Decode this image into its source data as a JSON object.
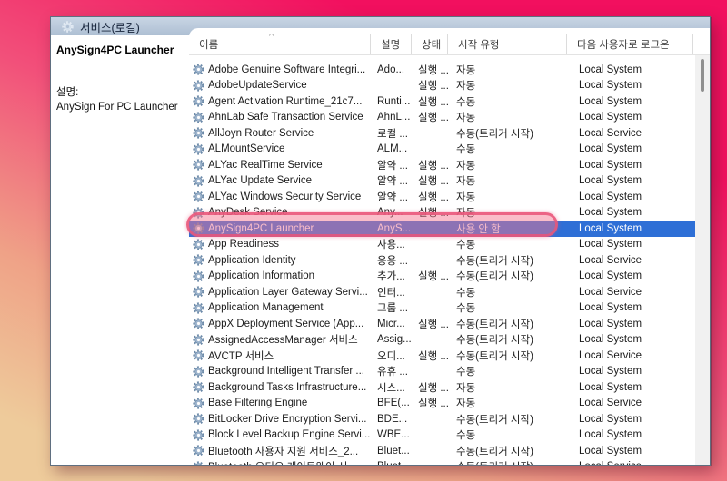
{
  "colors": {
    "page_bg_top": "#f2105f",
    "page_bg_bottom": "#eecb9b",
    "header_band": "#b7c7d9",
    "selection_blue": "#2e6fd6",
    "annotation_pink": "#ee6e8d",
    "gear_icon_blue": "#8ba6c3"
  },
  "icons": {
    "services_gear": "gear",
    "row_service_gear": "gear",
    "sort_asc": "^"
  },
  "window": {
    "header": {
      "title": "서비스(로컬)"
    },
    "left_panel": {
      "selected_service_name": "AnySign4PC Launcher",
      "description_label": "설명:",
      "description_text": "AnySign For PC Launcher"
    },
    "table": {
      "columns": [
        {
          "label": "이름",
          "sorted": "asc"
        },
        {
          "label": "설명"
        },
        {
          "label": "상태"
        },
        {
          "label": "시작 유형"
        },
        {
          "label": "다음 사용자로 로그온"
        }
      ],
      "rows": [
        {
          "name": "Adobe Genuine Software Integri...",
          "desc": "Ado...",
          "status": "실행 ...",
          "startup": "자동",
          "logon": "Local System",
          "selected": false
        },
        {
          "name": "AdobeUpdateService",
          "desc": "",
          "status": "실행 ...",
          "startup": "자동",
          "logon": "Local System",
          "selected": false
        },
        {
          "name": "Agent Activation Runtime_21c7...",
          "desc": "Runti...",
          "status": "실행 ...",
          "startup": "수동",
          "logon": "Local System",
          "selected": false
        },
        {
          "name": "AhnLab Safe Transaction Service",
          "desc": "AhnL...",
          "status": "실행 ...",
          "startup": "자동",
          "logon": "Local System",
          "selected": false
        },
        {
          "name": "AllJoyn Router Service",
          "desc": "로컬 ...",
          "status": "",
          "startup": "수동(트리거 시작)",
          "logon": "Local Service",
          "selected": false
        },
        {
          "name": "ALMountService",
          "desc": "ALM...",
          "status": "",
          "startup": "수동",
          "logon": "Local System",
          "selected": false
        },
        {
          "name": "ALYac RealTime Service",
          "desc": "알약 ...",
          "status": "실행 ...",
          "startup": "자동",
          "logon": "Local System",
          "selected": false
        },
        {
          "name": "ALYac Update Service",
          "desc": "알약 ...",
          "status": "실행 ...",
          "startup": "자동",
          "logon": "Local System",
          "selected": false
        },
        {
          "name": "ALYac Windows Security Service",
          "desc": "알약 ...",
          "status": "실행 ...",
          "startup": "자동",
          "logon": "Local System",
          "selected": false
        },
        {
          "name": "AnyDesk Service",
          "desc": "Any...",
          "status": "실행 ...",
          "startup": "자동",
          "logon": "Local System",
          "selected": false
        },
        {
          "name": "AnySign4PC Launcher",
          "desc": "AnyS...",
          "status": "",
          "startup": "사용 안 함",
          "logon": "Local System",
          "selected": true
        },
        {
          "name": "App Readiness",
          "desc": "사용...",
          "status": "",
          "startup": "수동",
          "logon": "Local System",
          "selected": false
        },
        {
          "name": "Application Identity",
          "desc": "응용 ...",
          "status": "",
          "startup": "수동(트리거 시작)",
          "logon": "Local Service",
          "selected": false
        },
        {
          "name": "Application Information",
          "desc": "추가...",
          "status": "실행 ...",
          "startup": "수동(트리거 시작)",
          "logon": "Local System",
          "selected": false
        },
        {
          "name": "Application Layer Gateway Servi...",
          "desc": "인터...",
          "status": "",
          "startup": "수동",
          "logon": "Local Service",
          "selected": false
        },
        {
          "name": "Application Management",
          "desc": "그룹 ...",
          "status": "",
          "startup": "수동",
          "logon": "Local System",
          "selected": false
        },
        {
          "name": "AppX Deployment Service (App...",
          "desc": "Micr...",
          "status": "실행 ...",
          "startup": "수동(트리거 시작)",
          "logon": "Local System",
          "selected": false
        },
        {
          "name": "AssignedAccessManager 서비스",
          "desc": "Assig...",
          "status": "",
          "startup": "수동(트리거 시작)",
          "logon": "Local System",
          "selected": false
        },
        {
          "name": "AVCTP 서비스",
          "desc": "오디...",
          "status": "실행 ...",
          "startup": "수동(트리거 시작)",
          "logon": "Local Service",
          "selected": false
        },
        {
          "name": "Background Intelligent Transfer ...",
          "desc": "유휴 ...",
          "status": "",
          "startup": "수동",
          "logon": "Local System",
          "selected": false
        },
        {
          "name": "Background Tasks Infrastructure...",
          "desc": "시스...",
          "status": "실행 ...",
          "startup": "자동",
          "logon": "Local System",
          "selected": false
        },
        {
          "name": "Base Filtering Engine",
          "desc": "BFE(...",
          "status": "실행 ...",
          "startup": "자동",
          "logon": "Local Service",
          "selected": false
        },
        {
          "name": "BitLocker Drive Encryption Servi...",
          "desc": "BDE...",
          "status": "",
          "startup": "수동(트리거 시작)",
          "logon": "Local System",
          "selected": false
        },
        {
          "name": "Block Level Backup Engine Servi...",
          "desc": "WBE...",
          "status": "",
          "startup": "수동",
          "logon": "Local System",
          "selected": false
        },
        {
          "name": "Bluetooth 사용자 지원 서비스_2...",
          "desc": "Bluet...",
          "status": "",
          "startup": "수동(트리거 시작)",
          "logon": "Local System",
          "selected": false
        },
        {
          "name": "Bluetooth 오디오 게이트웨이 서...",
          "desc": "Bluet...",
          "status": "",
          "startup": "수동(트리거 시작)",
          "logon": "Local Service",
          "selected": false
        }
      ]
    }
  }
}
